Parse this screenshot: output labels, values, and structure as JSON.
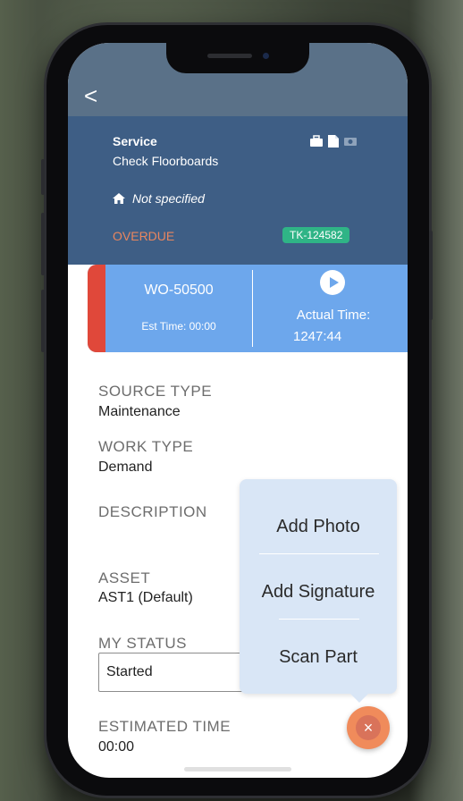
{
  "nav": {
    "back_glyph": "<"
  },
  "header": {
    "service_title": "Service",
    "service_subtitle": "Check Floorboards",
    "location": "Not specified",
    "status": "OVERDUE",
    "ticket": "TK-124582",
    "icons": [
      "briefcase-icon",
      "document-icon",
      "camera-icon"
    ]
  },
  "timebar": {
    "work_order": "WO-50500",
    "est_time": "Est Time: 00:00",
    "actual_label": "Actual Time:",
    "actual_value": "1247:44"
  },
  "fields": {
    "source_type_label": "SOURCE TYPE",
    "source_type_value": "Maintenance",
    "work_type_label": "WORK TYPE",
    "work_type_value": "Demand",
    "description_label": "DESCRIPTION",
    "asset_label": "ASSET",
    "asset_value": "AST1 (Default)",
    "my_status_label": "MY STATUS",
    "my_status_value": "Started",
    "estimated_time_label": "ESTIMATED TIME",
    "estimated_time_value": "00:00"
  },
  "menu": {
    "add_photo": "Add Photo",
    "add_signature": "Add Signature",
    "scan_part": "Scan Part"
  },
  "fab": {
    "close_glyph": "×"
  },
  "colors": {
    "header_bg": "#3e5e85",
    "timebar_bg": "#6da7ec",
    "overdue": "#e9865f",
    "ticket_badge": "#2fb486",
    "alert_stripe": "#e0483a",
    "fab": "#f08b5b",
    "menu_bg": "#d9e6f6"
  }
}
